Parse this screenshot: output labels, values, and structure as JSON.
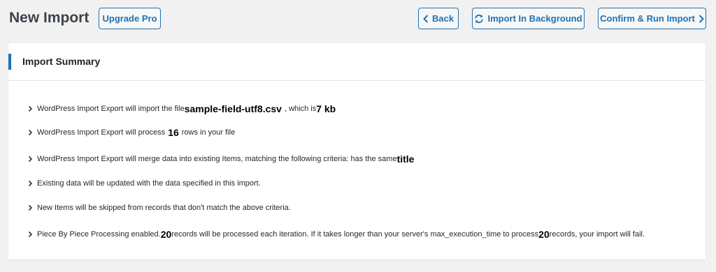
{
  "header": {
    "title": "New Import",
    "upgrade_label": "Upgrade Pro",
    "back_label": "Back",
    "background_label": "Import In Background",
    "confirm_label": "Confirm & Run Import"
  },
  "summary": {
    "title": "Import Summary",
    "line1": {
      "pre": "WordPress Import Export will import the file ",
      "file": "sample-field-utf8.csv",
      "mid": " , which is ",
      "size": "7 kb"
    },
    "line2": {
      "pre": "WordPress Import Export will process ",
      "rows": "16",
      "post": " rows in your file"
    },
    "line3": {
      "pre": "WordPress Import Export will merge data into existing Items, matching the following criteria: has the same ",
      "field": "title"
    },
    "line4": "Existing data will be updated with the data specified in this import.",
    "line5": "New Items will be skipped from records that don't match the above criteria.",
    "line6": {
      "pre": "Piece By Piece Processing enabled. ",
      "count1": "20",
      "mid": " records will be processed each iteration. If it takes longer than your server's max_execution_time to process ",
      "count2": "20",
      "post": " records, your import will fail."
    }
  },
  "icons": {
    "back": "chevron-left-icon",
    "background": "refresh-icon",
    "confirm": "chevron-right-icon",
    "bullet": "chevron-right-icon"
  }
}
